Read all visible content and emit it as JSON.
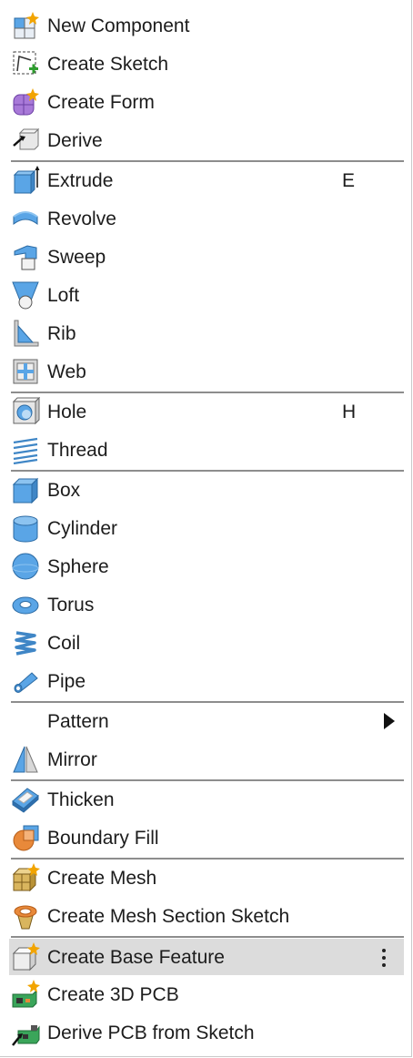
{
  "menu": {
    "items": [
      {
        "label": "New Component",
        "icon": "new-component-icon"
      },
      {
        "label": "Create Sketch",
        "icon": "create-sketch-icon"
      },
      {
        "label": "Create Form",
        "icon": "create-form-icon"
      },
      {
        "label": "Derive",
        "icon": "derive-icon"
      },
      {
        "label": "Extrude",
        "icon": "extrude-icon",
        "shortcut": "E"
      },
      {
        "label": "Revolve",
        "icon": "revolve-icon"
      },
      {
        "label": "Sweep",
        "icon": "sweep-icon"
      },
      {
        "label": "Loft",
        "icon": "loft-icon"
      },
      {
        "label": "Rib",
        "icon": "rib-icon"
      },
      {
        "label": "Web",
        "icon": "web-icon"
      },
      {
        "label": "Hole",
        "icon": "hole-icon",
        "shortcut": "H"
      },
      {
        "label": "Thread",
        "icon": "thread-icon"
      },
      {
        "label": "Box",
        "icon": "box-icon"
      },
      {
        "label": "Cylinder",
        "icon": "cylinder-icon"
      },
      {
        "label": "Sphere",
        "icon": "sphere-icon"
      },
      {
        "label": "Torus",
        "icon": "torus-icon"
      },
      {
        "label": "Coil",
        "icon": "coil-icon"
      },
      {
        "label": "Pipe",
        "icon": "pipe-icon"
      },
      {
        "label": "Pattern",
        "icon": "submenu-arrow-icon",
        "submenu": true
      },
      {
        "label": "Mirror",
        "icon": "mirror-icon"
      },
      {
        "label": "Thicken",
        "icon": "thicken-icon"
      },
      {
        "label": "Boundary Fill",
        "icon": "boundary-fill-icon"
      },
      {
        "label": "Create Mesh",
        "icon": "create-mesh-icon"
      },
      {
        "label": "Create Mesh Section Sketch",
        "icon": "create-mesh-section-sketch-icon"
      },
      {
        "label": "Create Base Feature",
        "icon": "create-base-feature-icon",
        "highlighted": true,
        "more_icon": "more-options-icon"
      },
      {
        "label": "Create 3D PCB",
        "icon": "create-3d-pcb-icon"
      },
      {
        "label": "Derive PCB from Sketch",
        "icon": "derive-pcb-from-sketch-icon"
      }
    ]
  },
  "colors": {
    "accent_blue": "#5aa5e6",
    "highlight_bg": "#dcdcdc",
    "separator": "#8d8d8d",
    "sparkle": "#f2a400",
    "add_green": "#2f9e2f",
    "form_purple": "#a879d8",
    "fill_orange": "#e8893a",
    "pcb_green": "#3aa55a"
  }
}
